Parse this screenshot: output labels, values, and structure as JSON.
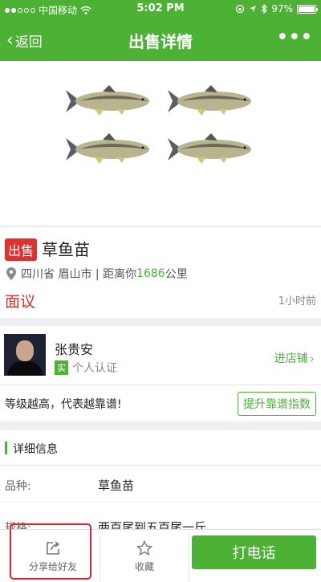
{
  "status_bar": {
    "carrier": "中国移动",
    "time": "5:02 PM",
    "battery": "97%"
  },
  "nav": {
    "back_label": "返回",
    "title": "出售详情",
    "more_label": "•••"
  },
  "listing": {
    "tag": "出售",
    "name": "草鱼苗",
    "location_prefix": "四川省 眉山市 | 距离你",
    "distance": "1686",
    "distance_unit": "公里",
    "price": "面议",
    "posted": "1小时前"
  },
  "seller": {
    "name": "张贵安",
    "badge": "实",
    "verify_text": "个人认证",
    "shop_label": "进店铺"
  },
  "level": {
    "text": "等级越高，代表越靠谱!",
    "button": "提升靠谱指数"
  },
  "details": {
    "section_title": "详细信息",
    "rows": [
      {
        "key": "品种:",
        "value": "草鱼苗"
      },
      {
        "key": "规格:",
        "value": "两百尾到五百尾一斤"
      }
    ]
  },
  "bottom_bar": {
    "share_label": "分享给好友",
    "favorite_label": "收藏",
    "call_label": "打电话"
  },
  "colors": {
    "brand_green": "#4cb134",
    "sell_red": "#e03131",
    "price_red": "#d6332c",
    "highlight_red": "#e0232a"
  }
}
